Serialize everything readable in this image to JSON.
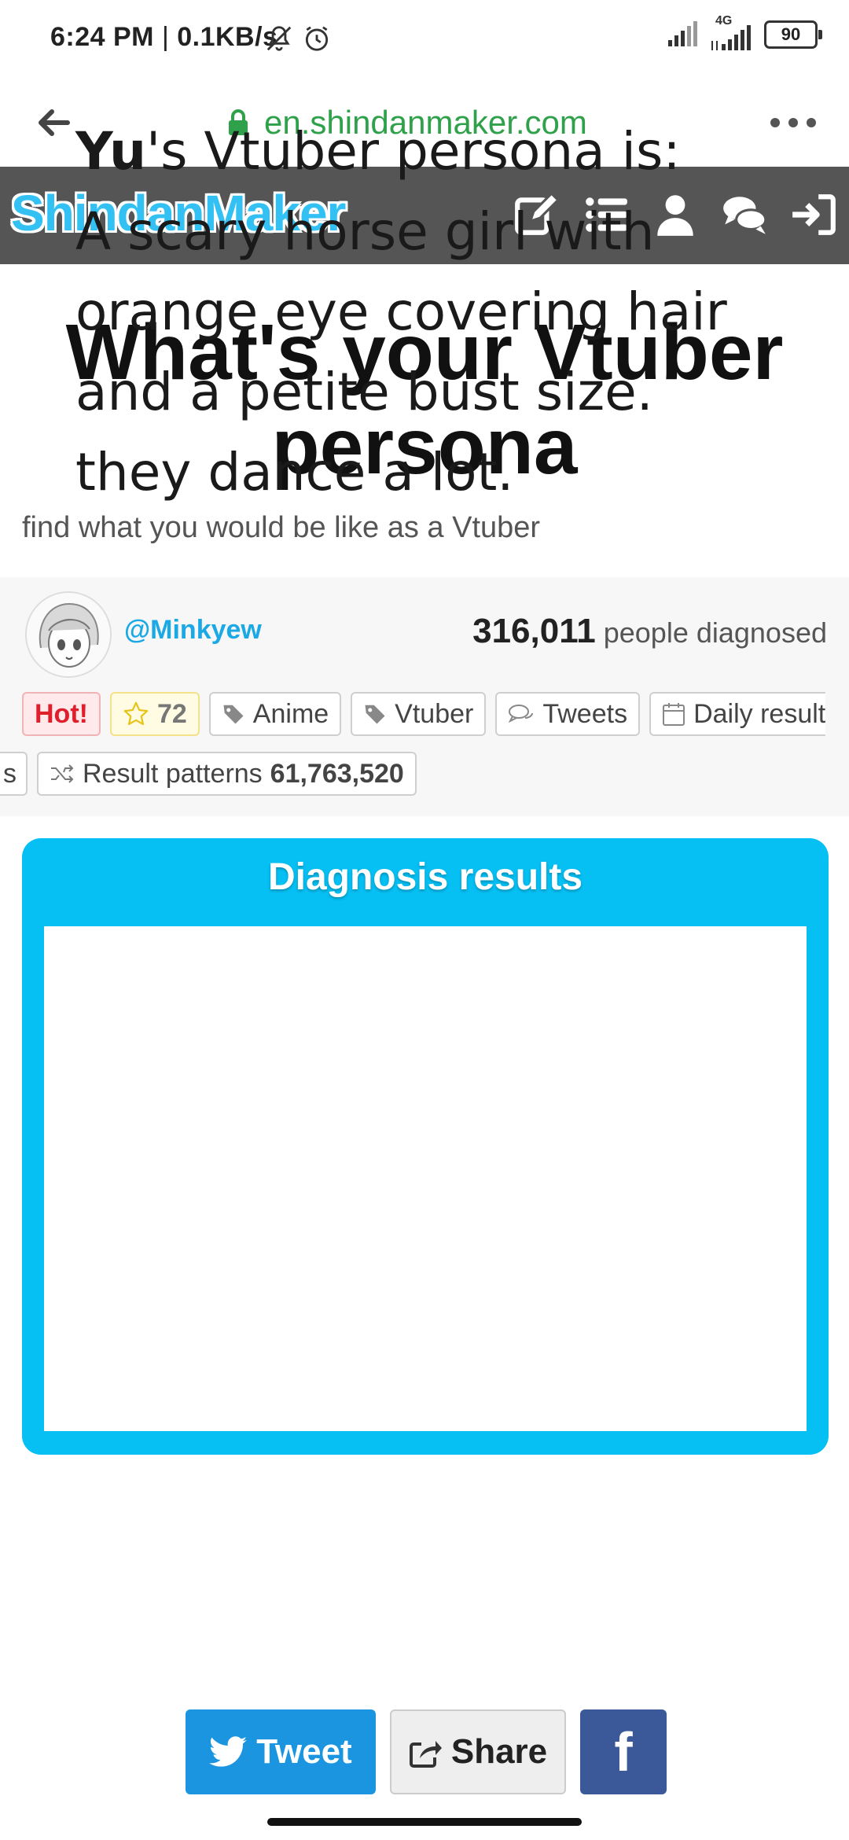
{
  "status_bar": {
    "time": "6:24 PM",
    "speed": "0.1KB/s",
    "network_label": "4G",
    "battery": "90",
    "icons": [
      "bell-off-icon",
      "alarm-icon",
      "signal-icon",
      "signal-4g-icon",
      "battery-icon"
    ]
  },
  "browser": {
    "url": "en.shindanmaker.com",
    "back_icon": "back-arrow-icon",
    "lock_icon": "lock-icon",
    "menu_icon": "more-dots-icon"
  },
  "site_header": {
    "logo": "ShindanMaker",
    "icons": [
      "edit-icon",
      "list-icon",
      "user-icon",
      "chat-icon",
      "sign-in-icon"
    ]
  },
  "page": {
    "title_line1": "What's your Vtuber",
    "title_line2": "persona",
    "description": "find what you would be like as a Vtuber"
  },
  "author": {
    "handle": "@Minkyew",
    "count": "316,011",
    "count_suffix": "people diagnosed"
  },
  "tags": {
    "hot": "Hot!",
    "favorites": "72",
    "anime": "Anime",
    "vtuber": "Vtuber",
    "tweets": "Tweets",
    "daily_result_part1": "Daily result",
    "daily_result_part2": "s",
    "patterns_label": "Result patterns",
    "patterns_value": "61,763,520"
  },
  "results": {
    "heading": "Diagnosis results",
    "name": "Yu",
    "line1_rest": "'s Vtuber persona is:",
    "line2": "A scary horse girl with",
    "line3": "orange eye covering hair",
    "line4": "and a petite bust size.",
    "line5": "they dance a lot."
  },
  "share": {
    "tweet": "Tweet",
    "share": "Share",
    "facebook": "f"
  },
  "colors": {
    "header_bg": "#555555",
    "logo": "#33c0f2",
    "url": "#2fa14b",
    "results_frame": "#06bff3",
    "tweet": "#1b95e0",
    "facebook": "#3b5998",
    "author": "#1ba9e6"
  }
}
